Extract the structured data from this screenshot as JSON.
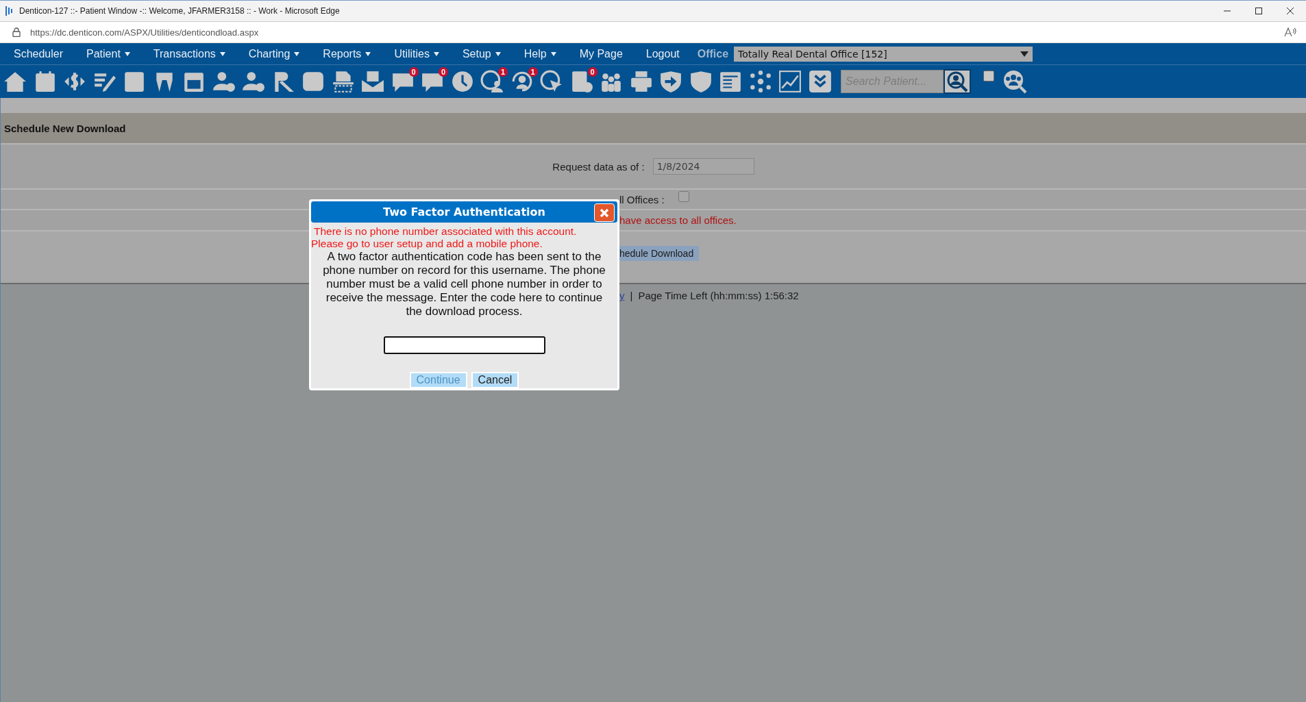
{
  "window": {
    "title": "Denticon-127 ::- Patient Window -:: Welcome, JFARMER3158 :: - Work - Microsoft Edge"
  },
  "address_bar": {
    "url": "https://dc.denticon.com/ASPX/Utilities/denticondload.aspx"
  },
  "menu": [
    {
      "label": "Scheduler",
      "has_dropdown": false
    },
    {
      "label": "Patient",
      "has_dropdown": true
    },
    {
      "label": "Transactions",
      "has_dropdown": true
    },
    {
      "label": "Charting",
      "has_dropdown": true
    },
    {
      "label": "Reports",
      "has_dropdown": true
    },
    {
      "label": "Utilities",
      "has_dropdown": true
    },
    {
      "label": "Setup",
      "has_dropdown": true
    },
    {
      "label": "Help",
      "has_dropdown": true
    },
    {
      "label": "My Page",
      "has_dropdown": false
    },
    {
      "label": "Logout",
      "has_dropdown": false
    }
  ],
  "office": {
    "label": "Office",
    "value": "Totally Real Dental Office [152]"
  },
  "toolbar": {
    "badges": [
      "0",
      "0",
      "1",
      "1",
      "0"
    ],
    "search": {
      "placeholder": "Search Patient..."
    },
    "checkbox": {
      "checked": false
    }
  },
  "page": {
    "title": "Schedule New Download",
    "request_label": "Request data as of :",
    "request_date": "1/8/2024",
    "all_offices_label": "ll Offices :",
    "all_offices_checked": false,
    "access_note": "have access to all offices.",
    "schedule_button": "hedule Download",
    "footer_link": "y",
    "footer_separator": "|",
    "footer_text": "Page Time Left (hh:mm:ss) 1:56:32"
  },
  "dialog": {
    "title": "Two Factor Authentication",
    "errors": [
      "There is no phone number associated with this account.",
      "Please go to user setup and add a mobile phone."
    ],
    "message": "A two factor authentication code has been sent to the phone number on record for this username. The phone number must be a valid cell phone number in order to receive the message. Enter the code here to continue the download process.",
    "buttons": [
      {
        "label": "Continue",
        "disabled": true
      },
      {
        "label": "Cancel",
        "disabled": false
      }
    ]
  }
}
